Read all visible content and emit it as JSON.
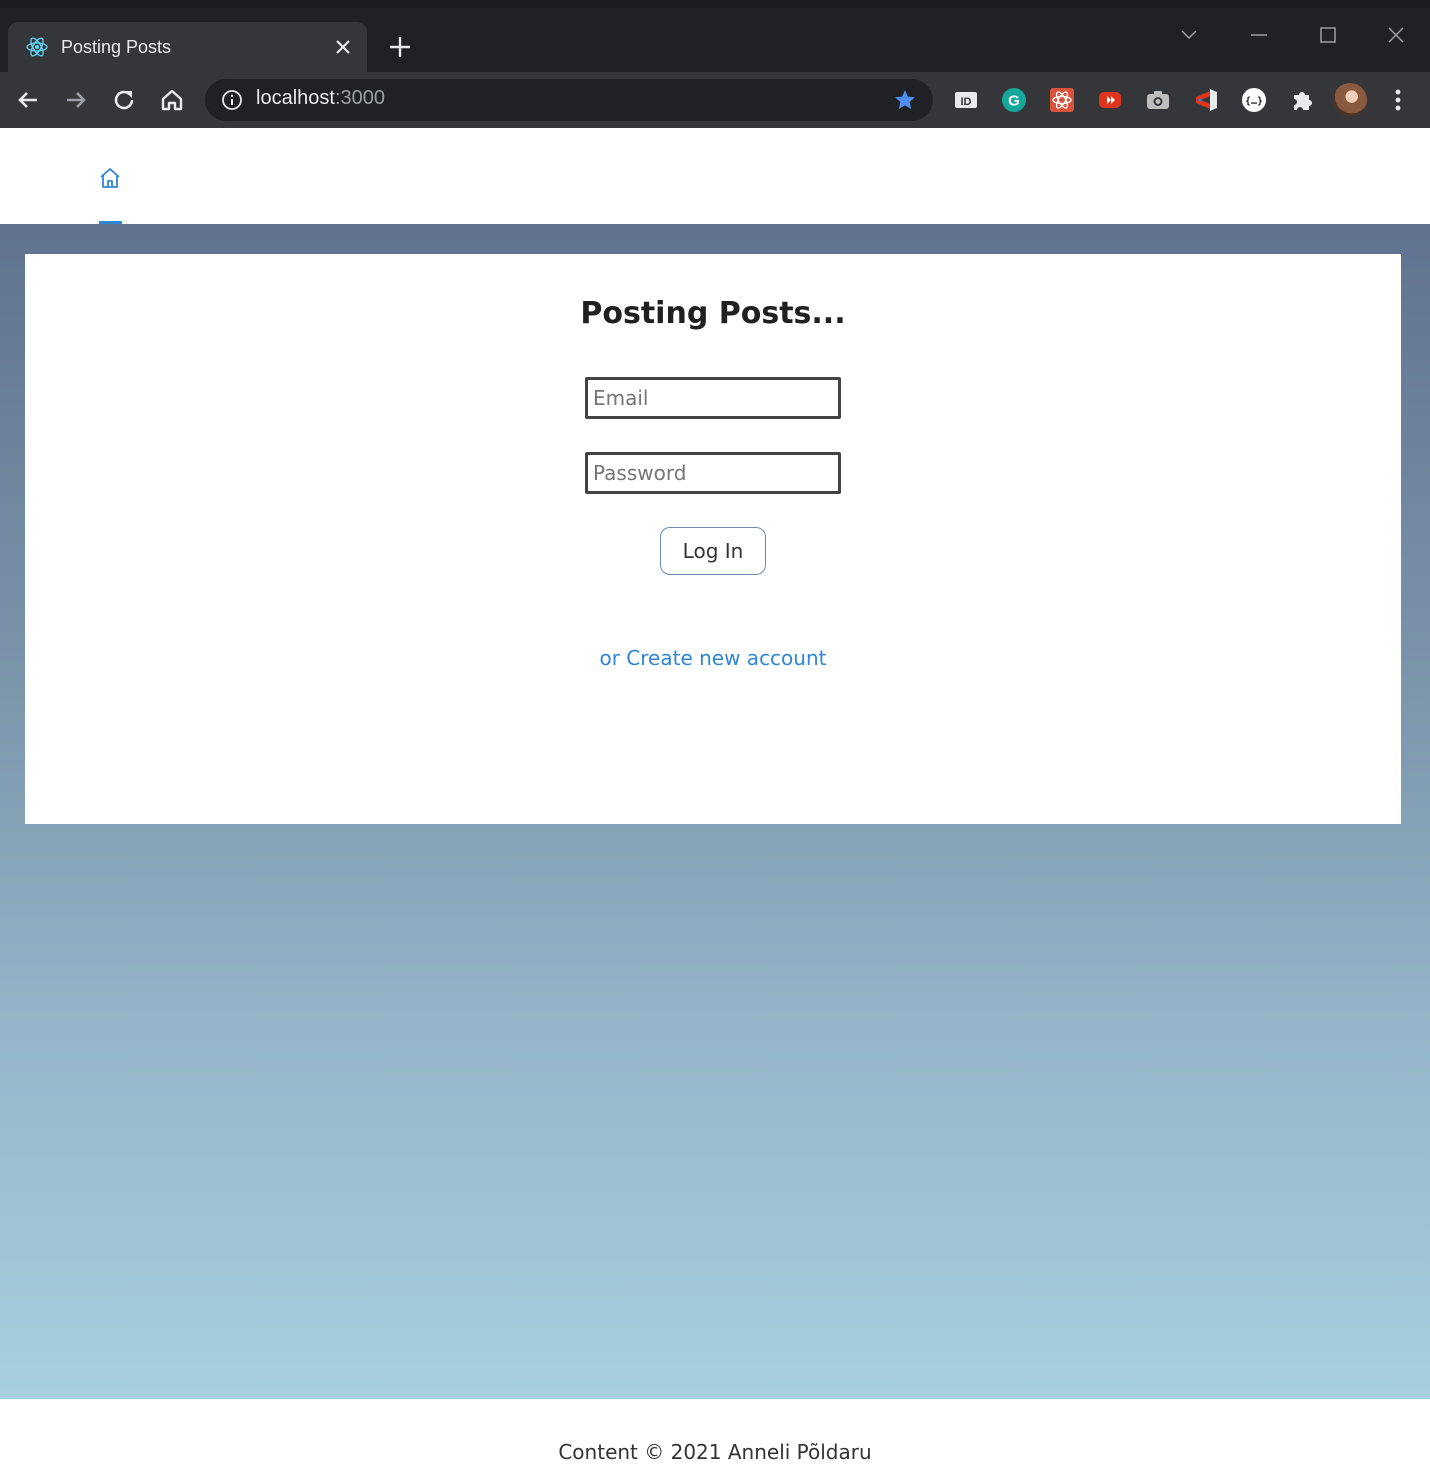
{
  "browser": {
    "tab_title": "Posting Posts",
    "url_host": "localhost",
    "url_port": ":3000",
    "icons": {
      "favicon": "react-atom-icon",
      "tab_close": "close-icon",
      "new_tab": "plus-icon",
      "back": "back-arrow-icon",
      "forward": "forward-arrow-icon",
      "reload": "reload-icon",
      "home": "home-icon",
      "site_info": "info-icon",
      "bookmark": "star-icon",
      "extensions": "puzzle-icon",
      "menu": "kebab-menu-icon"
    },
    "extensions": [
      "id-extension-icon",
      "grammarly-icon",
      "react-devtools-icon",
      "video-extension-icon",
      "camera-extension-icon",
      "vscode-extension-icon",
      "json-viewer-icon"
    ]
  },
  "nav": {
    "home_icon": "home-icon",
    "active_color": "#2f86d6"
  },
  "login": {
    "title": "Posting Posts...",
    "email_placeholder": "Email",
    "password_placeholder": "Password",
    "submit_label": "Log In",
    "create_account_label": "or Create new account"
  },
  "footer": {
    "text": "Content © 2021 Anneli Põldaru"
  },
  "colors": {
    "link": "#2f86d6",
    "background_top": "#60728f",
    "background_bottom": "#a7d0de"
  }
}
